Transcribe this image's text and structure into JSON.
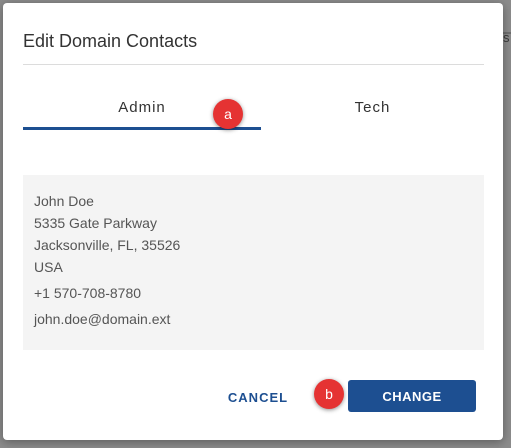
{
  "modal": {
    "title": "Edit Domain Contacts"
  },
  "tabs": [
    {
      "label": "Admin",
      "active": true
    },
    {
      "label": "Tech",
      "active": false
    }
  ],
  "markers": {
    "a": "a",
    "b": "b"
  },
  "contact": {
    "name": "John Doe",
    "street": "5335 Gate Parkway",
    "city_line": "Jacksonville, FL, 35526",
    "country": "USA",
    "phone": "+1 570-708-8780",
    "email": "john.doe@domain.ext"
  },
  "actions": {
    "cancel_label": "CANCEL",
    "change_label": "CHANGE"
  },
  "background": {
    "edge_text_right": "s"
  },
  "colors": {
    "accent": "#1d4f91",
    "marker": "#e53333",
    "card_bg": "#f4f4f4"
  }
}
